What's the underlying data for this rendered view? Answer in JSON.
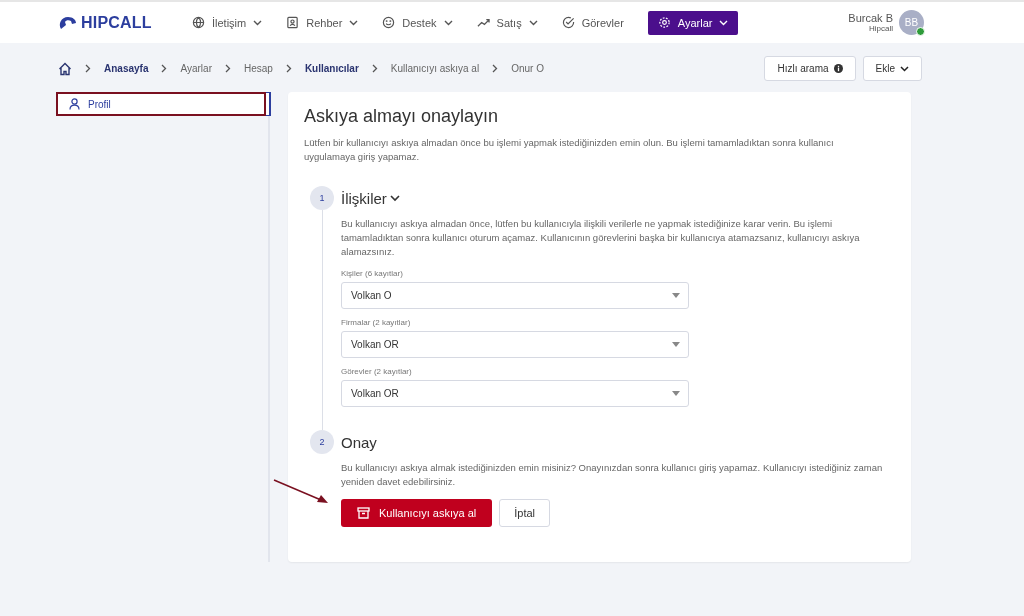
{
  "brand": {
    "name": "HIPCALL"
  },
  "nav": [
    {
      "label": "İletişim",
      "dropdown": true,
      "selected": false
    },
    {
      "label": "Rehber",
      "dropdown": true,
      "selected": false
    },
    {
      "label": "Destek",
      "dropdown": true,
      "selected": false
    },
    {
      "label": "Satış",
      "dropdown": true,
      "selected": false
    },
    {
      "label": "Görevler",
      "dropdown": false,
      "selected": false
    },
    {
      "label": "Ayarlar",
      "dropdown": true,
      "selected": true
    }
  ],
  "user": {
    "name": "Burcak B",
    "company": "Hipcall",
    "initials": "BB",
    "online": true
  },
  "breadcrumb": [
    {
      "label": "Anasayfa",
      "link": true
    },
    {
      "label": "Ayarlar",
      "link": false
    },
    {
      "label": "Hesap",
      "link": false
    },
    {
      "label": "Kullanıcılar",
      "link": true
    },
    {
      "label": "Kullanıcıyı askıya al",
      "link": false
    },
    {
      "label": "Onur O",
      "link": false
    }
  ],
  "quick_search": {
    "label": "Hızlı arama"
  },
  "add_button": {
    "label": "Ekle"
  },
  "sidebar": {
    "items": [
      {
        "label": "Profil",
        "selected": true,
        "highlighted": true
      }
    ]
  },
  "card": {
    "title": "Askıya almayı onaylayın",
    "description": "Lütfen bir kullanıcıyı askıya almadan önce bu işlemi yapmak istediğinizden emin olun. Bu işlemi tamamladıktan sonra kullanıcı uygulamaya giriş yapamaz.",
    "steps": [
      {
        "number": "1",
        "title": "İlişkiler",
        "collapsible": true,
        "text": "Bu kullanıcıyı askıya almadan önce, lütfen bu kullanıcıyla ilişkili verilerle ne yapmak istediğinize karar verin. Bu işlemi tamamladıktan sonra kullanıcı oturum açamaz. Kullanıcının görevlerini başka bir kullanıcıya atamazsanız, kullanıcıyı askıya alamazsınız.",
        "fields": [
          {
            "label": "Kişiler (6 kayıtlar)",
            "value": "Volkan O"
          },
          {
            "label": "Firmalar (2 kayıtlar)",
            "value": "Volkan OR"
          },
          {
            "label": "Görevler (2 kayıtlar)",
            "value": "Volkan OR"
          }
        ]
      },
      {
        "number": "2",
        "title": "Onay",
        "collapsible": false,
        "text": "Bu kullanıcıyı askıya almak istediğinizden emin misiniz? Onayınızdan sonra kullanıcı giriş yapamaz. Kullanıcıyı istediğiniz zaman yeniden davet edebilirsiniz."
      }
    ],
    "primary_button": {
      "label": "Kullanıcıyı askıya al",
      "annotated": true
    },
    "cancel_button": {
      "label": "İptal"
    }
  }
}
